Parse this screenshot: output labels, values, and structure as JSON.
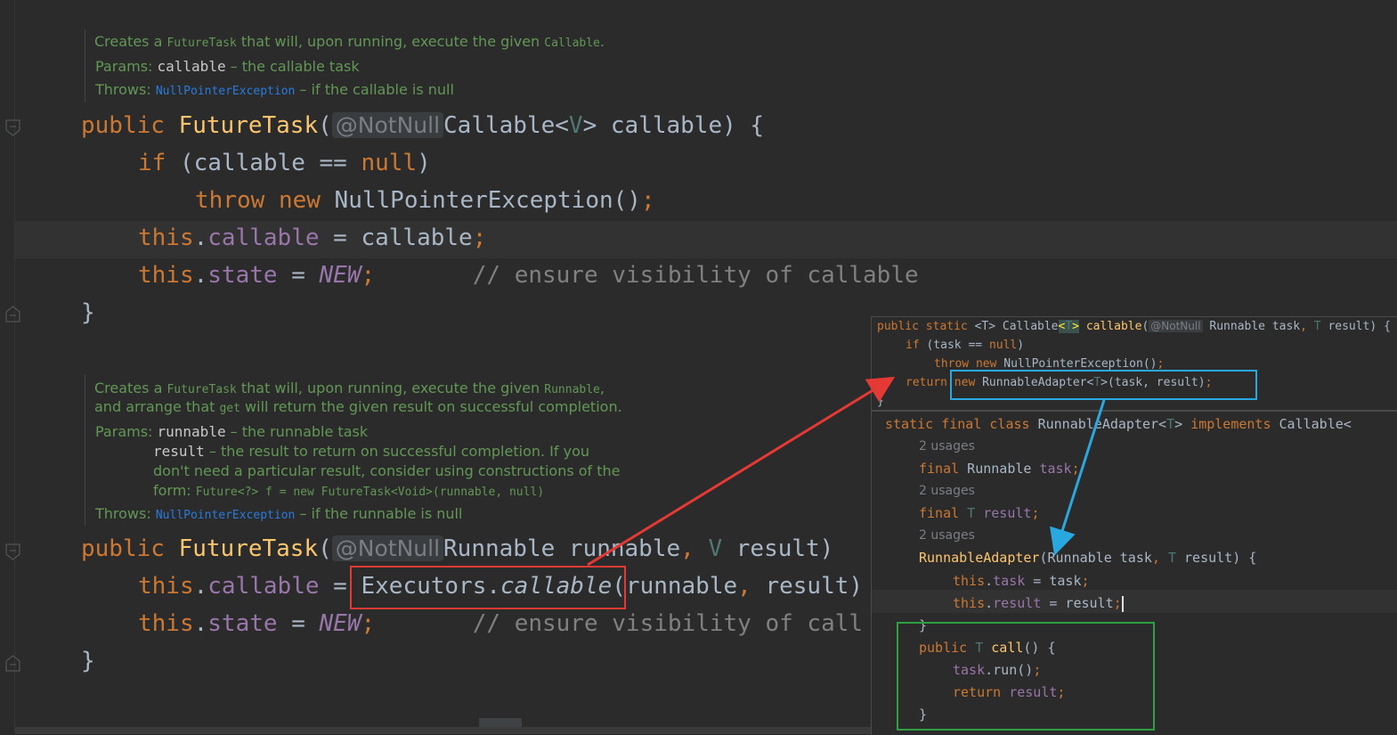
{
  "doc1": {
    "l1_a": "Creates a ",
    "l1_code1": "FutureTask",
    "l1_b": " that will, upon running, execute the given ",
    "l1_code2": "Callable",
    "l1_c": ".",
    "params_label": "Params: ",
    "p1_name": "callable",
    "p1_desc": " – the callable task",
    "throws_label": "Throws: ",
    "throws_link": "NullPointerException",
    "throws_desc": " – if the callable is null"
  },
  "code1": {
    "kw_public": "public",
    "ctor_name": "FutureTask",
    "paren_open": "(",
    "annotation": "@NotNull",
    "type": "Callable<",
    "gen_v": "V",
    "type_end": "> callable) {",
    "if_kw": "if",
    "if_cond": " (callable == ",
    "null_kw": "null",
    "if_close": ")",
    "throw_kw": "throw",
    "new_kw": "new",
    "npe": " NullPointerException()",
    "semi": ";",
    "this1": "this",
    "dot_callable": ".",
    "fld_callable": "callable",
    "assign_callable": " = callable",
    "this2": "this",
    "dot_state": ".",
    "fld_state": "state",
    "assign": " = ",
    "const_new": "NEW",
    "comment": "// ensure visibility of callable",
    "close": "}"
  },
  "doc2": {
    "l1_a": "Creates a ",
    "l1_code1": "FutureTask",
    "l1_b": " that will, upon running, execute the given ",
    "l1_code2": "Runnable",
    "l1_c": ",",
    "l2_a": "and arrange that ",
    "l2_code": "get",
    "l2_b": " will return the given result on successful completion.",
    "params_label": "Params: ",
    "p1_name": "runnable",
    "p1_desc": " – the runnable task",
    "p2_name": "result",
    "p2_desc": " – the result to return on successful completion. If you",
    "p2_l2": "don't need a particular result, consider using constructions of the",
    "p2_l3a": "form: ",
    "p2_l3code": "Future<?> f = new FutureTask<Void>(runnable, null)",
    "throws_label": "Throws: ",
    "throws_link": "NullPointerException",
    "throws_desc": " – if the runnable is null"
  },
  "code2": {
    "kw_public": "public",
    "ctor_name": "FutureTask",
    "paren_open": "(",
    "annotation": "@NotNull",
    "type": "Runnable runnable",
    "comma": ",",
    "gen_v": " V",
    "tail": " result)",
    "this1": "this",
    "dot": ".",
    "fld_callable": "callable",
    "assign": " = ",
    "executors": "Executors.",
    "callable_call": "callable",
    "args": "(runnable",
    "comma2": ",",
    "args2": " result)",
    "this2": "this",
    "fld_state": "state",
    "const_new": "NEW",
    "semi": ";",
    "comment": "// ensure visibility of call",
    "close": "}"
  },
  "popup1": {
    "sig_a": "public static ",
    "sig_t": "<T>",
    "sig_b": " Callable",
    "sig_t2a": "<",
    "sig_t2": "T",
    "sig_t2b": ">",
    "sig_fn": " callable",
    "sig_paren": "(",
    "sig_ann": "@NotNull",
    "sig_c": " Runnable task",
    "sig_comma": ",",
    "sig_tt": " T",
    "sig_d": " result) {",
    "if_kw": "if",
    "if_cond": " (task == ",
    "null_kw": "null",
    "if_close": ")",
    "throw_kw": "throw",
    "new_kw": "new",
    "npe": " NullPointerException()",
    "semi": ";",
    "ret_kw": "return",
    "new2": "new",
    "adapter": " RunnableAdapter<",
    "adapter_t": "T",
    "adapter_end": ">(task, result)",
    "semi2": ";",
    "close": "}"
  },
  "popup2": {
    "decl_a": "static final class ",
    "decl_name": "RunnableAdapter<",
    "decl_t": "T",
    "decl_b": "> ",
    "decl_impl": "implements",
    "decl_c": " Callable<",
    "usages1": "2 usages",
    "f1_kw": "final",
    "f1_type": " Runnable ",
    "f1_name": "task",
    "f1_semi": ";",
    "usages2": "2 usages",
    "f2_kw": "final",
    "f2_t": " T ",
    "f2_name": "result",
    "f2_semi": ";",
    "usages3": "2 usages",
    "ctor": "RunnableAdapter",
    "ctor_args": "(Runnable task",
    "ctor_comma": ",",
    "ctor_t": " T",
    "ctor_end": " result) {",
    "a1_this": "this",
    "a1_dot": ".",
    "a1_fld": "task",
    "a1_rest": " = task",
    "a1_semi": ";",
    "a2_this": "this",
    "a2_dot": ".",
    "a2_fld": "result",
    "a2_rest": " = result",
    "a2_semi": ";",
    "close1": "}",
    "call_kw": "public",
    "call_t": " T ",
    "call_fn": "call",
    "call_end": "() {",
    "run_obj": "task",
    "run_call": ".run()",
    "run_semi": ";",
    "ret_kw": "return",
    "ret_val": " result",
    "ret_semi": ";",
    "close2": "}"
  },
  "colors": {
    "red": "#e53935",
    "blue": "#29a8e0",
    "green": "#2ea043"
  }
}
